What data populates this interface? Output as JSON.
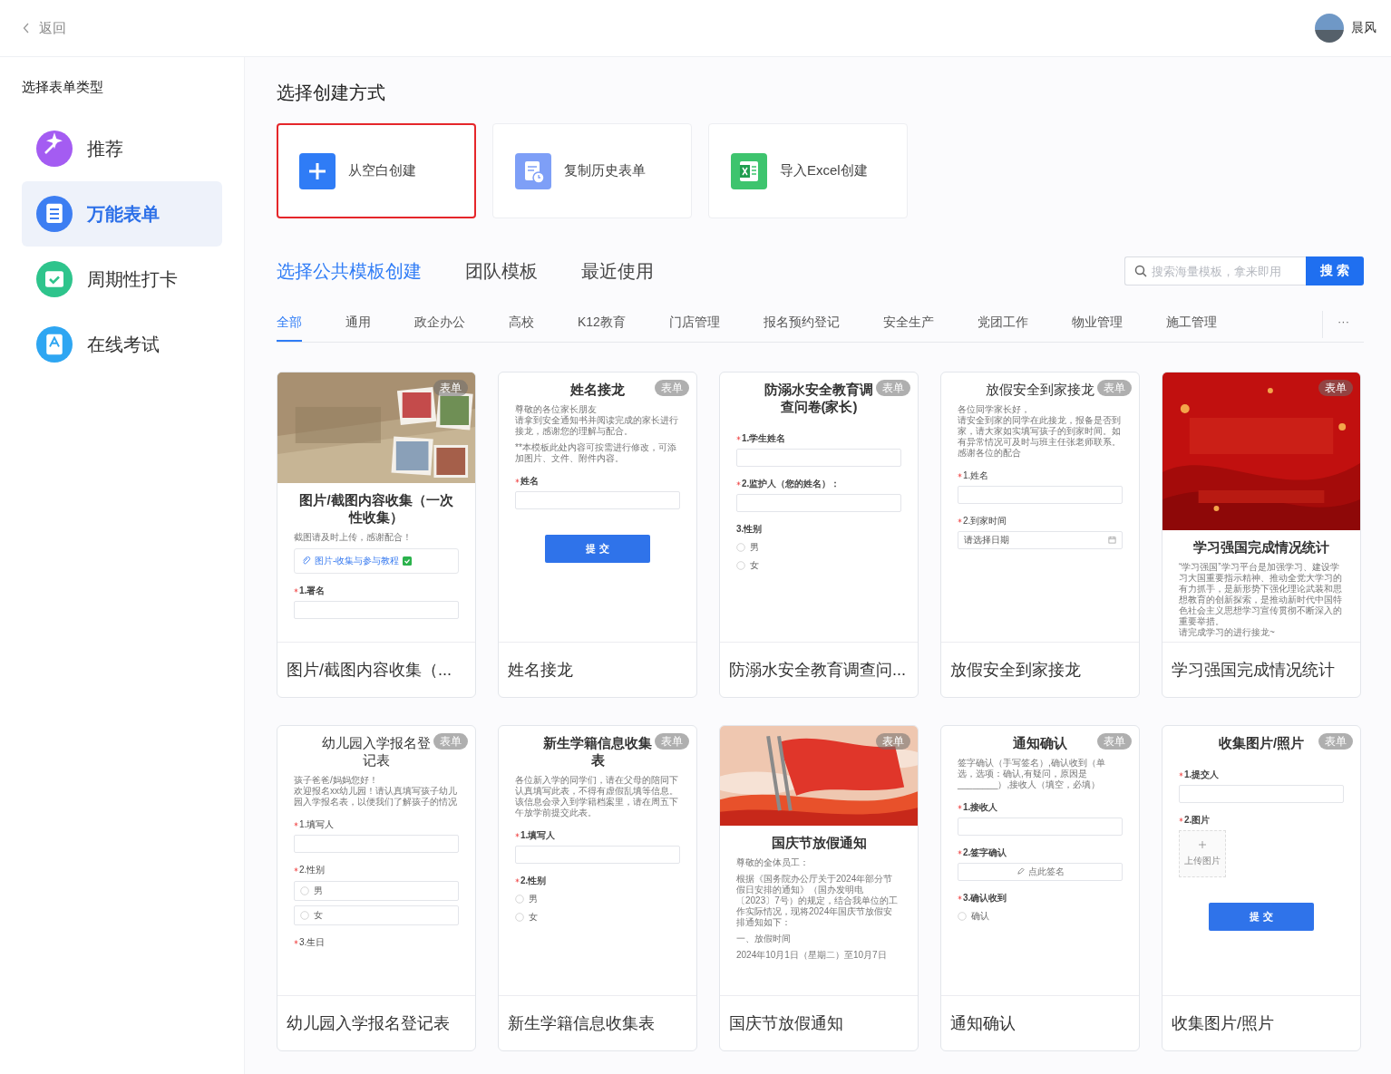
{
  "header": {
    "back": "返回",
    "user": "晨风"
  },
  "sidebar": {
    "title": "选择表单类型",
    "items": [
      {
        "label": "推荐",
        "color": "#a45cf2",
        "selected": false
      },
      {
        "label": "万能表单",
        "color": "#3d7ef2",
        "selected": true
      },
      {
        "label": "周期性打卡",
        "color": "#2ec48c",
        "selected": false
      },
      {
        "label": "在线考试",
        "color": "#2ea6f2",
        "selected": false
      }
    ]
  },
  "create": {
    "title": "选择创建方式",
    "methods": [
      {
        "kind": "blank",
        "label": "从空白创建",
        "selected": true
      },
      {
        "kind": "copy",
        "label": "复制历史表单",
        "selected": false
      },
      {
        "kind": "excel",
        "label": "导入Excel创建",
        "selected": false
      }
    ]
  },
  "tabs": [
    {
      "label": "选择公共模板创建",
      "selected": true
    },
    {
      "label": "团队模板",
      "selected": false
    },
    {
      "label": "最近使用",
      "selected": false
    }
  ],
  "search": {
    "placeholder": "搜索海量模板，拿来即用",
    "button": "搜 索"
  },
  "categories": [
    {
      "label": "全部",
      "selected": true
    },
    {
      "label": "通用",
      "selected": false
    },
    {
      "label": "政企办公",
      "selected": false
    },
    {
      "label": "高校",
      "selected": false
    },
    {
      "label": "K12教育",
      "selected": false
    },
    {
      "label": "门店管理",
      "selected": false
    },
    {
      "label": "报名预约登记",
      "selected": false
    },
    {
      "label": "安全生产",
      "selected": false
    },
    {
      "label": "党团工作",
      "selected": false
    },
    {
      "label": "物业管理",
      "selected": false
    },
    {
      "label": "施工管理",
      "selected": false
    }
  ],
  "more": "···",
  "templates": [
    {
      "title": "图片/截图内容收集（...",
      "badge": "表单",
      "blocks": [
        {
          "kind": "picture"
        },
        {
          "kind": "heading",
          "bold": true,
          "text": "图片/截图内容收集（一次性收集）"
        },
        {
          "kind": "paragraph",
          "text": "截图请及时上传，感谢配合！"
        },
        {
          "kind": "link",
          "text": "图片-收集与参与教程"
        },
        {
          "kind": "label",
          "required": true,
          "bold": true,
          "text": "1.署名"
        },
        {
          "kind": "input"
        }
      ]
    },
    {
      "title": "姓名接龙",
      "badge": "表单",
      "blocks": [
        {
          "kind": "heading",
          "bold": true,
          "text": "姓名接龙"
        },
        {
          "kind": "line",
          "text": "尊敬的各位家长朋友"
        },
        {
          "kind": "paragraph",
          "text": "请拿到安全通知书并阅读完成的家长进行接龙，感谢您的理解与配合。"
        },
        {
          "kind": "paragraph",
          "text": "**本模板此处内容可按需进行修改，可添加图片、文件、附件内容。"
        },
        {
          "kind": "label",
          "required": true,
          "bold": true,
          "text": "姓名"
        },
        {
          "kind": "input"
        },
        {
          "kind": "button",
          "text": "提 交"
        }
      ]
    },
    {
      "title": "防溺水安全教育调查问...",
      "badge": "表单",
      "blocks": [
        {
          "kind": "heading",
          "bold": true,
          "text": "防溺水安全教育调查问卷(家长)"
        },
        {
          "kind": "label",
          "required": true,
          "bold": true,
          "text": "1.学生姓名"
        },
        {
          "kind": "input"
        },
        {
          "kind": "label",
          "required": true,
          "bold": true,
          "text": "2.监护人（您的姓名）："
        },
        {
          "kind": "input"
        },
        {
          "kind": "label",
          "required": false,
          "bold": true,
          "text": "3.性别"
        },
        {
          "kind": "option",
          "checked": false,
          "text": "男"
        },
        {
          "kind": "option",
          "checked": false,
          "text": "女"
        }
      ]
    },
    {
      "title": "放假安全到家接龙",
      "badge": "表单",
      "blocks": [
        {
          "kind": "heading",
          "bold": false,
          "text": "放假安全到家接龙"
        },
        {
          "kind": "line",
          "text": "各位同学家长好，"
        },
        {
          "kind": "paragraph",
          "text": "请安全到家的同学在此接龙，报备是否到家，请大家如实填写孩子的到家时间。如有异常情况可及时与班主任张老师联系。感谢各位的配合"
        },
        {
          "kind": "label",
          "required": true,
          "bold": false,
          "text": "1.姓名"
        },
        {
          "kind": "input"
        },
        {
          "kind": "label",
          "required": true,
          "bold": false,
          "text": "2.到家时间"
        },
        {
          "kind": "date",
          "placeholder": "请选择日期"
        }
      ]
    },
    {
      "title": "学习强国完成情况统计",
      "badge": "表单",
      "blocks": [
        {
          "kind": "picture"
        },
        {
          "kind": "heading",
          "bold": true,
          "text": "学习强国完成情况统计"
        },
        {
          "kind": "line",
          "text": "“学习强国”学习平台是加强学习、建设学习大国重要指示精神、推动全党大学习的有力抓手，是新形势下强化理论武装和思想教育的创新探索，是推动新时代中国特色社会主义思想学习宣传贯彻不断深入的重要举措。"
        },
        {
          "kind": "paragraph",
          "text": "请完成学习的进行接龙~"
        }
      ]
    },
    {
      "title": "幼儿园入学报名登记表",
      "badge": "表单",
      "blocks": [
        {
          "kind": "heading",
          "bold": false,
          "text": "幼儿园入学报名登记表"
        },
        {
          "kind": "line",
          "text": "孩子爸爸/妈妈您好！"
        },
        {
          "kind": "paragraph",
          "text": "欢迎报名xx幼儿园！请认真填写孩子幼儿园入学报名表，以便我们了解孩子的情况"
        },
        {
          "kind": "label",
          "required": true,
          "bold": false,
          "text": "1.填写人"
        },
        {
          "kind": "input"
        },
        {
          "kind": "label",
          "required": true,
          "bold": false,
          "text": "2.性别"
        },
        {
          "kind": "boxed-option",
          "checked": false,
          "text": "男"
        },
        {
          "kind": "boxed-option",
          "checked": false,
          "text": "女"
        },
        {
          "kind": "label",
          "required": true,
          "bold": false,
          "text": "3.生日"
        }
      ]
    },
    {
      "title": "新生学籍信息收集表",
      "badge": "表单",
      "blocks": [
        {
          "kind": "heading",
          "bold": true,
          "text": "新生学籍信息收集表"
        },
        {
          "kind": "line",
          "text": "各位新入学的同学们，请在父母的陪同下认真填写此表，不得有虚假乱填等信息。"
        },
        {
          "kind": "paragraph",
          "text": "该信息会录入到学籍档案里，请在周五下午放学前提交此表。"
        },
        {
          "kind": "label",
          "required": true,
          "bold": true,
          "text": "1.填写人"
        },
        {
          "kind": "input"
        },
        {
          "kind": "label",
          "required": true,
          "bold": true,
          "text": "2.性别"
        },
        {
          "kind": "option",
          "checked": false,
          "text": "男"
        },
        {
          "kind": "option",
          "checked": false,
          "text": "女"
        }
      ]
    },
    {
      "title": "国庆节放假通知",
      "badge": "表单",
      "blocks": [
        {
          "kind": "picture"
        },
        {
          "kind": "heading",
          "bold": true,
          "text": "国庆节放假通知"
        },
        {
          "kind": "paragraph",
          "text": "尊敬的全体员工："
        },
        {
          "kind": "paragraph",
          "text": "根据《国务院办公厅关于2024年部分节假日安排的通知》（国办发明电〔2023〕7号）的规定，结合我单位的工作实际情况，现将2024年国庆节放假安排通知如下："
        },
        {
          "kind": "paragraph",
          "text": "一、放假时间"
        },
        {
          "kind": "paragraph",
          "text": "2024年10月1日（星期二）至10月7日"
        }
      ]
    },
    {
      "title": "通知确认",
      "badge": "表单",
      "blocks": [
        {
          "kind": "heading",
          "bold": true,
          "text": "通知确认"
        },
        {
          "kind": "paragraph",
          "text": "签字确认（手写签名）,确认收到（单选，选项：确认,有疑问，原因是________）,接收人（填空，必填）"
        },
        {
          "kind": "label",
          "required": true,
          "bold": true,
          "text": "1.接收人"
        },
        {
          "kind": "input"
        },
        {
          "kind": "label",
          "required": true,
          "bold": true,
          "text": "2.签字确认"
        },
        {
          "kind": "signature",
          "text": "点此签名"
        },
        {
          "kind": "label",
          "required": true,
          "bold": true,
          "text": "3.确认收到"
        },
        {
          "kind": "option",
          "checked": false,
          "text": "确认"
        }
      ]
    },
    {
      "title": "收集图片/照片",
      "badge": "表单",
      "blocks": [
        {
          "kind": "heading",
          "bold": true,
          "text": "收集图片/照片"
        },
        {
          "kind": "label",
          "required": true,
          "bold": true,
          "text": "1.提交人"
        },
        {
          "kind": "input"
        },
        {
          "kind": "label",
          "required": true,
          "bold": true,
          "text": "2.图片"
        },
        {
          "kind": "upload",
          "text": "上传图片"
        },
        {
          "kind": "button",
          "text": "提 交"
        }
      ]
    }
  ]
}
